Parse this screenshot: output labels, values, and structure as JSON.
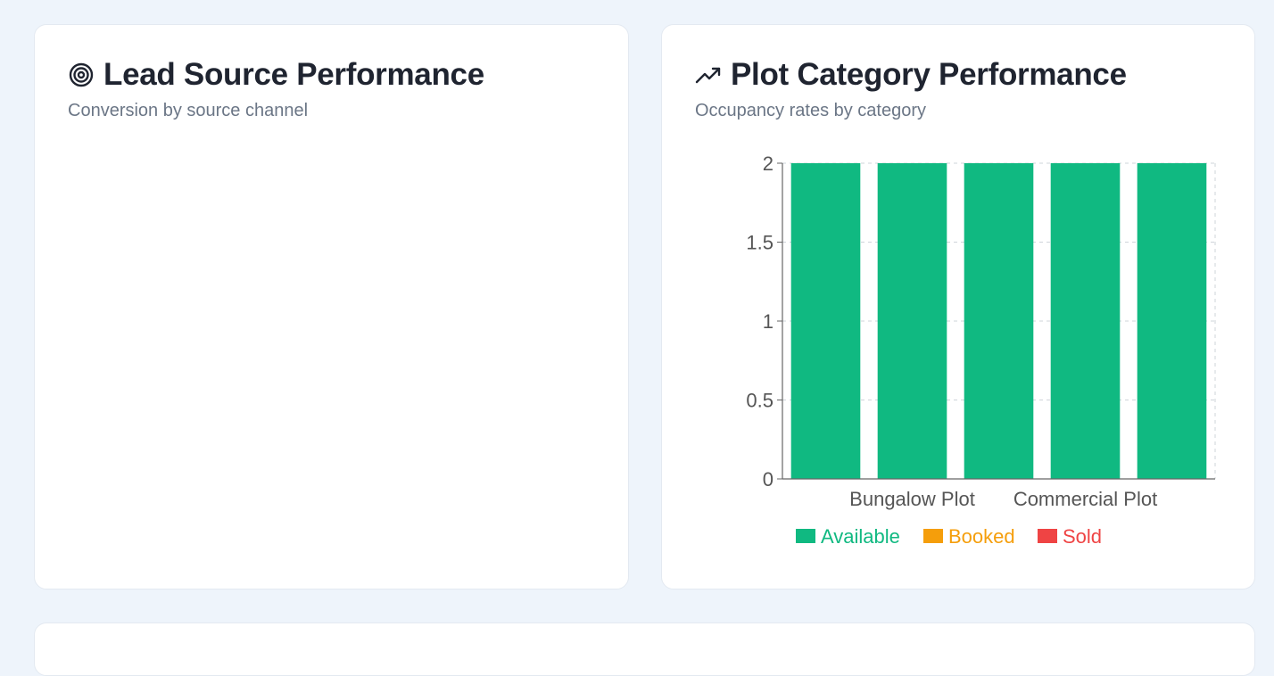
{
  "lead_card": {
    "title": "Lead Source Performance",
    "subtitle": "Conversion by source channel",
    "icon": "target-icon"
  },
  "plot_card": {
    "title": "Plot Category Performance",
    "subtitle": "Occupancy rates by category",
    "icon": "trending-up-icon"
  },
  "colors": {
    "available": "#10b981",
    "booked": "#f59e0b",
    "sold": "#ef4444"
  },
  "chart_data": {
    "type": "bar",
    "categories": [
      "",
      "Bungalow Plot",
      "",
      "Commercial Plot",
      ""
    ],
    "series": [
      {
        "name": "Available",
        "values": [
          2,
          2,
          2,
          2,
          2
        ]
      },
      {
        "name": "Booked",
        "values": [
          0,
          0,
          0,
          0,
          0
        ]
      },
      {
        "name": "Sold",
        "values": [
          0,
          0,
          0,
          0,
          0
        ]
      }
    ],
    "yticks": [
      "0",
      "0.5",
      "1",
      "1.5",
      "2"
    ],
    "ylim": [
      0,
      2
    ],
    "grid": true,
    "legend_position": "bottom",
    "xlabel": "",
    "ylabel": ""
  }
}
